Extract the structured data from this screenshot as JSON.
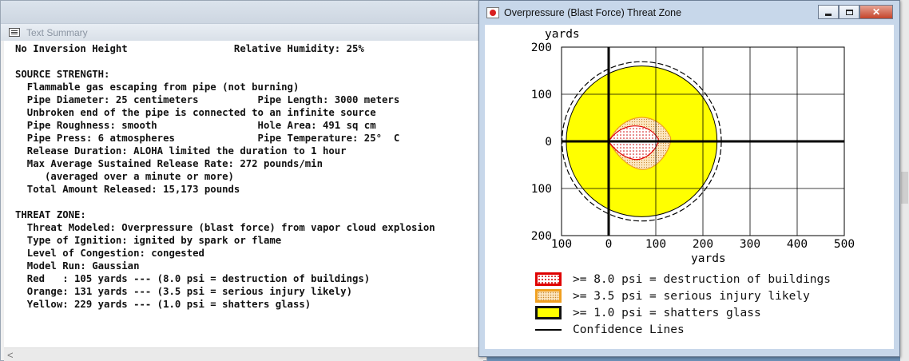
{
  "text_window": {
    "title": "Text Summary",
    "lines": [
      "No Inversion Height                  Relative Humidity: 25%",
      "",
      "SOURCE STRENGTH:",
      "  Flammable gas escaping from pipe (not burning)",
      "  Pipe Diameter: 25 centimeters          Pipe Length: 3000 meters",
      "  Unbroken end of the pipe is connected to an infinite source",
      "  Pipe Roughness: smooth                 Hole Area: 491 sq cm",
      "  Pipe Press: 6 atmospheres              Pipe Temperature: 25°  C",
      "  Release Duration: ALOHA limited the duration to 1 hour",
      "  Max Average Sustained Release Rate: 272 pounds/min",
      "     (averaged over a minute or more)",
      "  Total Amount Released: 15,173 pounds",
      "",
      "THREAT ZONE:",
      "  Threat Modeled: Overpressure (blast force) from vapor cloud explosion",
      "  Type of Ignition: ignited by spark or flame",
      "  Level of Congestion: congested",
      "  Model Run: Gaussian",
      "  Red   : 105 yards --- (8.0 psi = destruction of buildings)",
      "  Orange: 131 yards --- (3.5 psi = serious injury likely)",
      "  Yellow: 229 yards --- (1.0 psi = shatters glass)"
    ],
    "scroll_left": "<"
  },
  "threat_window": {
    "title": "Overpressure (Blast Force) Threat Zone",
    "buttons": {
      "minimize": "",
      "maximize": "",
      "close": "✕"
    },
    "legend": [
      {
        "label": ">= 8.0 psi = destruction of buildings",
        "color": "#e00000"
      },
      {
        "label": ">= 3.5 psi = serious injury likely",
        "color": "#f0a020"
      },
      {
        "label": ">= 1.0 psi = shatters glass",
        "color": "#ffff00"
      },
      {
        "label": "Confidence Lines",
        "color": "#000000"
      }
    ]
  },
  "chart_data": {
    "type": "area",
    "title": "Overpressure (Blast Force) Threat Zone",
    "xlabel": "yards",
    "ylabel": "yards",
    "xlim": [
      -100,
      500
    ],
    "ylim": [
      -200,
      200
    ],
    "x_ticks": [
      -100,
      0,
      100,
      200,
      300,
      400,
      500
    ],
    "x_tick_labels": [
      "100",
      "0",
      "100",
      "200",
      "300",
      "400",
      "500"
    ],
    "y_ticks": [
      200,
      100,
      0,
      -100,
      -200
    ],
    "y_tick_labels": [
      "200",
      "100",
      "0",
      "100",
      "200"
    ],
    "grid": true,
    "zones": [
      {
        "name": ">= 1.0 psi = shatters glass",
        "color": "#ffff00",
        "center": [
          70,
          0
        ],
        "radius": 160
      },
      {
        "name": ">= 3.5 psi = serious injury likely",
        "color": "#f0a020",
        "x_range": [
          0,
          131
        ],
        "half_width": 62
      },
      {
        "name": ">= 8.0 psi = destruction of buildings",
        "color": "#e00000",
        "x_range": [
          0,
          105
        ],
        "half_width": 40
      }
    ],
    "confidence_line": {
      "center": [
        70,
        0
      ],
      "radius": 169
    },
    "axis_lines": {
      "x": 0,
      "y": 0
    }
  }
}
